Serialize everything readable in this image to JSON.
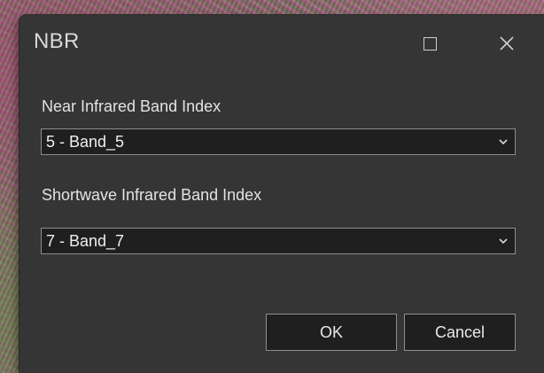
{
  "dialog": {
    "title": "NBR",
    "maximize_icon": "maximize-icon",
    "close_icon": "close-icon"
  },
  "fields": {
    "nir": {
      "label": "Near Infrared Band Index",
      "value": "5 - Band_5"
    },
    "swir": {
      "label": "Shortwave Infrared Band Index",
      "value": "7 - Band_7"
    }
  },
  "buttons": {
    "ok": "OK",
    "cancel": "Cancel"
  },
  "colors": {
    "dialog_bg": "#353535",
    "field_bg": "#1f1f1f",
    "border": "#8e8e8e",
    "text": "#e3e3e3"
  }
}
